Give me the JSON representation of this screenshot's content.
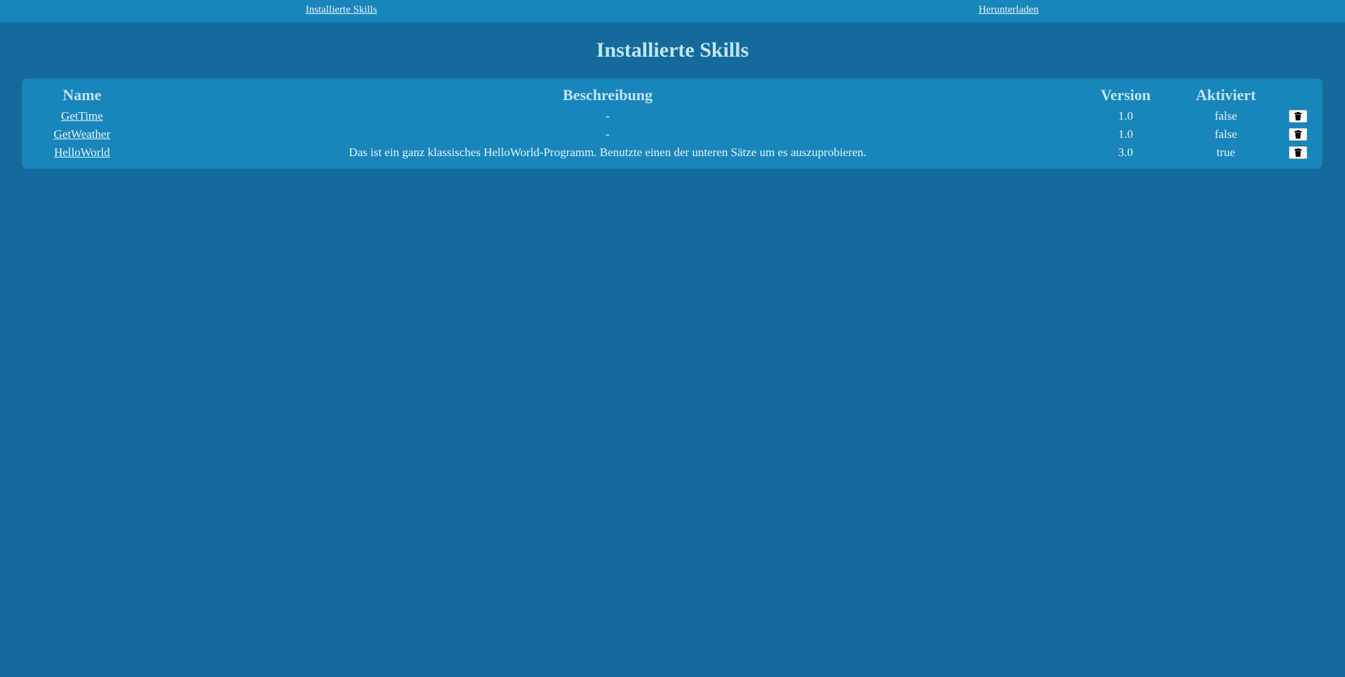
{
  "nav": {
    "installed_label": "Installierte Skills",
    "download_label": "Herunterladen"
  },
  "page": {
    "title": "Installierte Skills"
  },
  "table": {
    "headers": {
      "name": "Name",
      "description": "Beschreibung",
      "version": "Version",
      "active": "Aktiviert"
    },
    "rows": [
      {
        "name": "GetTime",
        "description": "-",
        "version": "1.0",
        "active": "false",
        "delete_icon": "trash-icon"
      },
      {
        "name": "GetWeather",
        "description": "-",
        "version": "1.0",
        "active": "false",
        "delete_icon": "trash-icon"
      },
      {
        "name": "HelloWorld",
        "description": "Das ist ein ganz klassisches HelloWorld-Programm. Benutzte einen der unteren Sätze um es auszuprobieren.",
        "version": "3.0",
        "active": "true",
        "delete_icon": "trash-icon"
      }
    ]
  },
  "colors": {
    "background": "#146a9a",
    "panel": "#1885bb",
    "heading": "#bfe6f7",
    "text": "#e6f5fc"
  }
}
